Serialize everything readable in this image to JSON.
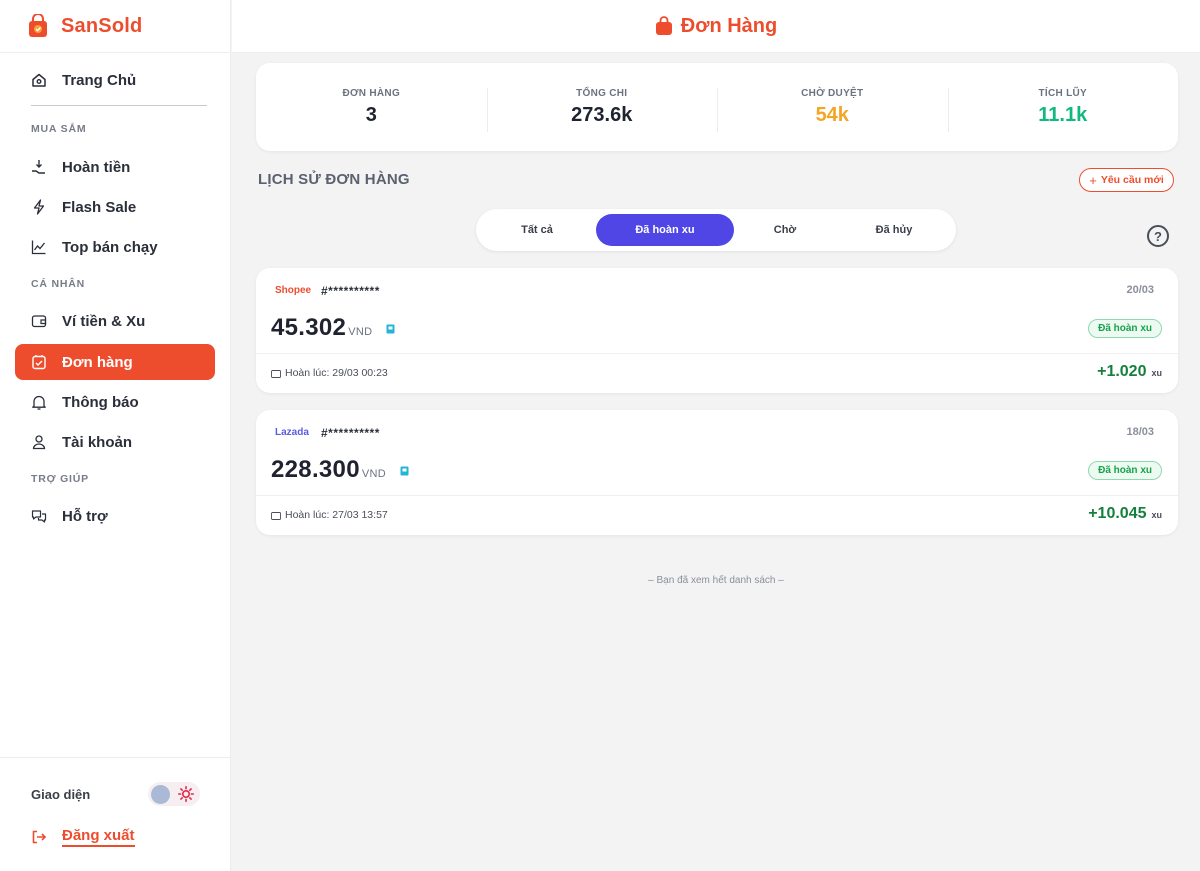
{
  "brand": {
    "name": "SanSold",
    "color": "#ee4d2d"
  },
  "header": {
    "title": "Đơn Hàng"
  },
  "sidebar": {
    "home": "Trang Chủ",
    "sections": {
      "shopping": "MUA SẮM",
      "personal": "CÁ NHÂN",
      "help": "TRỢ GIÚP"
    },
    "items": [
      {
        "label": "Hoàn tiền",
        "icon": "cashback-icon"
      },
      {
        "label": "Flash Sale",
        "icon": "lightning-icon"
      },
      {
        "label": "Top bán chạy",
        "icon": "chart-icon"
      },
      {
        "label": "Ví tiền & Xu",
        "icon": "wallet-icon"
      },
      {
        "label": "Đơn hàng",
        "icon": "orders-icon",
        "active": true
      },
      {
        "label": "Thông báo",
        "icon": "bell-icon"
      },
      {
        "label": "Tài khoản",
        "icon": "user-icon"
      },
      {
        "label": "Hỗ trợ",
        "icon": "chat-icon"
      }
    ],
    "theme_label": "Giao diện",
    "logout": "Đăng xuất"
  },
  "stats": [
    {
      "label": "ĐƠN HÀNG",
      "value": "3",
      "color": "#1f2330"
    },
    {
      "label": "TỔNG CHI",
      "value": "273.6k",
      "color": "#1f2330"
    },
    {
      "label": "CHỜ DUYỆT",
      "value": "54k",
      "color": "#f5a524"
    },
    {
      "label": "TÍCH LŨY",
      "value": "11.1k",
      "color": "#10b981"
    }
  ],
  "history": {
    "title": "LỊCH SỬ ĐƠN HÀNG",
    "new_request": "Yêu cầu mới",
    "help": "?"
  },
  "tabs": [
    {
      "label": "Tất cả"
    },
    {
      "label": "Đã hoàn xu",
      "active": true
    },
    {
      "label": "Chờ"
    },
    {
      "label": "Đã hủy"
    }
  ],
  "orders": [
    {
      "platform": "Shopee",
      "platform_color": "#ee4d2d",
      "code": "#**********",
      "date": "20/03",
      "amount": "45.302",
      "currency": "VND",
      "status": "Đã hoàn xu",
      "refund_time": "Hoàn lúc: 29/03 00:23",
      "coins": "+1.020",
      "coin_unit": "xu"
    },
    {
      "platform": "Lazada",
      "platform_color": "#5b5ce2",
      "code": "#**********",
      "date": "18/03",
      "amount": "228.300",
      "currency": "VND",
      "status": "Đã hoàn xu",
      "refund_time": "Hoàn lúc: 27/03 13:57",
      "coins": "+10.045",
      "coin_unit": "xu"
    }
  ],
  "end_note": "– Bạn đã xem hết danh sách –"
}
